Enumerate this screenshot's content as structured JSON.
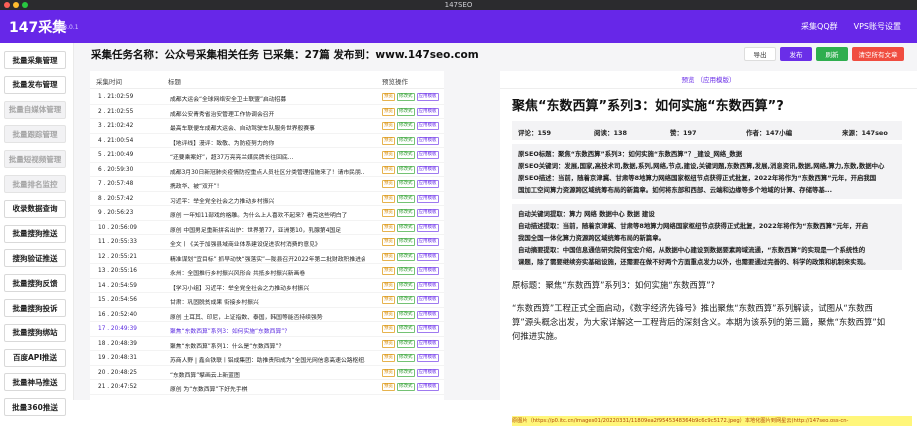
{
  "window": {
    "title": "147SEO"
  },
  "app": {
    "name": "147采集",
    "version": "v1.3.0.1"
  },
  "top_nav": [
    "采集QQ群",
    "VPS账号设置"
  ],
  "sidebar": [
    {
      "label": "批量采集管理",
      "enabled": true
    },
    {
      "label": "批量发布管理",
      "enabled": true
    },
    {
      "label": "批量自媒体管理",
      "enabled": false
    },
    {
      "label": "批量跟踪管理",
      "enabled": false
    },
    {
      "label": "批量短视频管理",
      "enabled": false
    },
    {
      "label": "批量排名监控",
      "enabled": false
    },
    {
      "label": "收录数据查询",
      "enabled": true
    },
    {
      "label": "批量搜狗推送",
      "enabled": true
    },
    {
      "label": "搜狗验证推送",
      "enabled": true
    },
    {
      "label": "批量搜狗反馈",
      "enabled": true
    },
    {
      "label": "批量搜狗投诉",
      "enabled": true
    },
    {
      "label": "批量搜狗绑站",
      "enabled": true
    },
    {
      "label": "百度API推送",
      "enabled": true
    },
    {
      "label": "批量神马推送",
      "enabled": true
    },
    {
      "label": "批量360推送",
      "enabled": true
    }
  ],
  "header": {
    "task_title": "采集任务名称：公众号采集相关任务 已采集：27篇 发布到：www.147seo.com"
  },
  "toolbar": {
    "export": "导出",
    "publish": "发布",
    "refresh": "刷新",
    "replace": "清空所有文章"
  },
  "table": {
    "headers": {
      "time": "采集时间",
      "title": "标题",
      "ops": "预览操作"
    },
    "tags": {
      "preview": "预览",
      "format": "修改式",
      "apply": "应用模板"
    },
    "rows": [
      {
        "time": "1 . 21:02:59",
        "title": "成都大运会“全球网络安全卫士联盟”启动招募"
      },
      {
        "time": "2 . 21:02:55",
        "title": "成都公安青秀省治安管理工作协调会召开"
      },
      {
        "time": "3 . 21:02:42",
        "title": "最高车联便车成都大运会、自动驾驶车队服务世界般赛事"
      },
      {
        "time": "4 . 21:00:54",
        "title": "【地评线】漫评：致敬、为防疫努力的你"
      },
      {
        "time": "5 . 21:00:49",
        "title": "“还要乘案好”，超37万亮亮兰媒民牌长往回底..."
      },
      {
        "time": "6 . 20:59:30",
        "title": "成都3月30日新冠肺炎疫情防控重点人员社区分类管理措施来了！请市民朋..."
      },
      {
        "time": "7 . 20:57:48",
        "title": "携政华、被“双开”！"
      },
      {
        "time": "8 . 20:57:42",
        "title": "习近平：举全党全社会之力推动乡村振兴"
      },
      {
        "time": "9 . 20:56:23",
        "title": "原创 一年知11部戏的格雕。为什么上人喜欢不起来？看完这些明白了"
      },
      {
        "time": "10 . 20:56:09",
        "title": "原创 中国男足重新拼名出炉：世界第77，亚洲第10，乳腺第4国足"
      },
      {
        "time": "11 . 20:55:33",
        "title": "全文丨《关于加强县域商业体系建设促进农村消费的意见》"
      },
      {
        "time": "12 . 20:55:21",
        "title": "精准谋划“宜目标” 抓早动快“强落实”—陇县召开2022年第二批财政积推进会..."
      },
      {
        "time": "13 . 20:55:16",
        "title": "永州：全国推行乡村振兴风形合 共抵乡村振兴新画卷"
      },
      {
        "time": "14 . 20:54:59",
        "title": "【学习小组】习近平：举全党全社会之力推动乡村振兴"
      },
      {
        "time": "15 . 20:54:56",
        "title": "甘肃：巩固脱贫成果 衔接乡村振兴"
      },
      {
        "time": "16 . 20:52:40",
        "title": "原创 土耳其、印尼，上证指数、泰国，韩国等能否持续强势"
      },
      {
        "time": "17 . 20:49:39",
        "title": "聚焦“东数西算”系列3：如何实施“东数西算”？"
      },
      {
        "time": "18 . 20:48:39",
        "title": "聚焦“东数西算”系列1：什么是“东数西算”？"
      },
      {
        "time": "19 . 20:48:31",
        "title": "苏商人野 | 鑫合铁联丨铝成集团：助推贵阳成为“全国光网信息高速公路枢纽..."
      },
      {
        "time": "20 . 20:48:25",
        "title": "“东数西算”擘画云上新蓝图"
      },
      {
        "time": "21 . 20:47:52",
        "title": "原创 为“东数西算”下好先手棋"
      }
    ],
    "selected_index": 16
  },
  "preview": {
    "header": "预览 （应用模版）",
    "title": "聚焦“东数西算”系列3：如何实施“东数西算”?",
    "meta": {
      "comments": "评论：159",
      "reads": "阅读：138",
      "likes": "赞：197",
      "author": "作者：147小编",
      "source": "来源：147seo"
    },
    "seo": [
      "原SEO标题：聚焦“东数西算”系列3：如何实施“东数西算”？_建设_网络_数据",
      "原SEO关键词：发展,国家,高技术司,数据,系列,网络,节点,建设,关键词题,东数西算,发展,消息资讯,数据,网络,算力,东数,数据中心",
      "原SEO描述：当前，随着京津冀、甘肃等8地算力网络国家枢纽节点获得正式批复，2022年将作为“东数西算”元年，开启我国",
      "国加工空间算力资源跨区域统筹布局的新篇章。如何将东部和西部、云端和边缘等多个地域的计算、存储等基..."
    ],
    "desc": [
      "自动关键词提取：算力 网络 数据中心 数据 建设",
      "自动描述提取：当前，随着京津冀、甘肃等8地算力网络国家枢纽节点获得正式批复，2022年将作为“东数西算”元年，开启",
      "我国全国一体化算力资源跨区域统筹布局的新篇章。",
      "自动摘要提取：中国信息通信研究院何宝宏介绍，从数据中心建设到数据要素跨域流通，“东数西算”的实现是一个系统性的",
      "课题，除了需要继续夯实基础设施，还需要在做不好两个方面重点发力以外，也需要通过完善的、科学的政策和机制来实现。"
    ],
    "body1": "原标题：聚焦“东数西算”系列3：如何实施“东数西算”?",
    "body2": "“东数西算”工程正式全面启动，《数字经济先锋号》推出聚焦“东数西算”系列解读，试图从“东数西算”源头概念出发，为大家详解这一工程背后的深刻含义。本期为该系列的第三篇，聚焦“东数西算”如何推进实施。",
    "link": "原图片（https://p0.itc.cn/images01/20220331/11809ea2f9545348364b9c6c9c5172.jpeg）本地化图片到网星云(http://147seo.oss-cn-"
  },
  "colors": {
    "brand": "#6727e8",
    "publish": "#6a2ee8",
    "refresh": "#2fae4f",
    "clear": "#f04d40"
  }
}
